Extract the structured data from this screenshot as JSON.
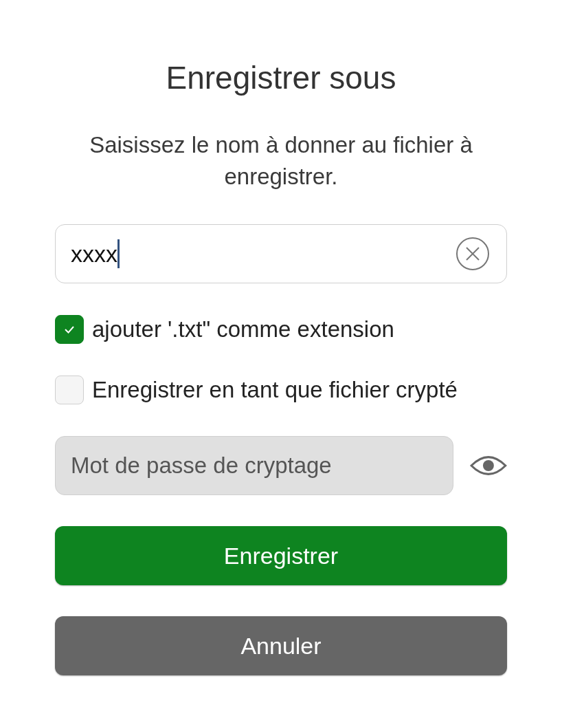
{
  "dialog": {
    "title": "Enregistrer sous",
    "message": "Saisissez le nom à donner au fichier à enregistrer."
  },
  "filename_field": {
    "value": "xxxx",
    "focused": true
  },
  "options": [
    {
      "label": "ajouter '.txt\" comme extension",
      "checked": true
    },
    {
      "label": "Enregistrer en tant que fichier crypté",
      "checked": false
    }
  ],
  "password_field": {
    "placeholder": "Mot de passe de cryptage",
    "disabled": true
  },
  "buttons": [
    {
      "label": "Enregistrer",
      "kind": "primary"
    },
    {
      "label": "Annuler",
      "kind": "secondary"
    }
  ]
}
